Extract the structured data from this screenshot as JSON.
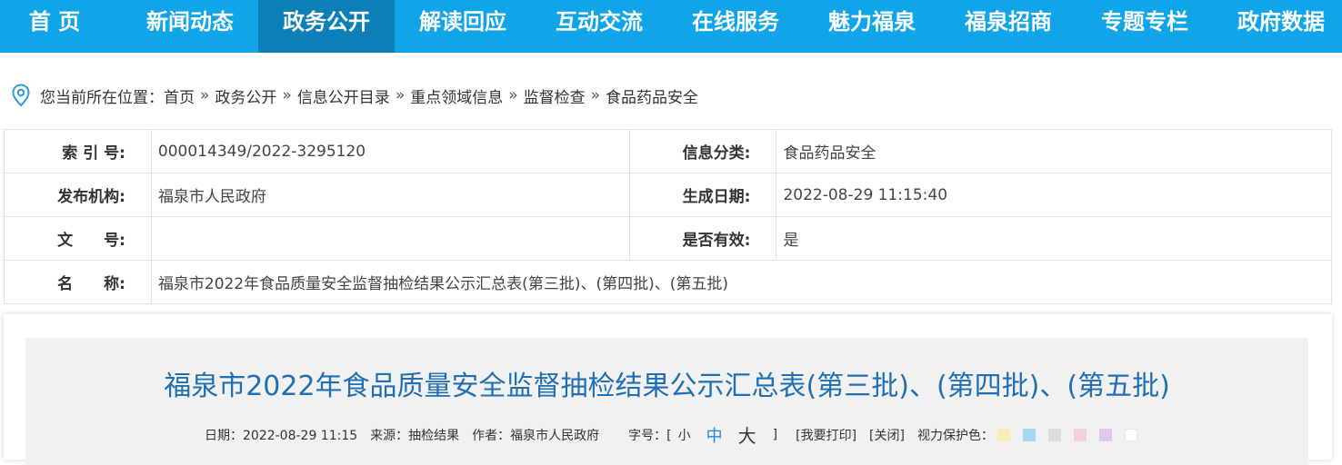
{
  "nav": {
    "items": [
      "首 页",
      "新闻动态",
      "政务公开",
      "解读回应",
      "互动交流",
      "在线服务",
      "魅力福泉",
      "福泉招商",
      "专题专栏",
      "政府数据"
    ],
    "active_index": 2
  },
  "breadcrumb": {
    "prefix": "您当前所在位置：",
    "items": [
      "首页",
      "政务公开",
      "信息公开目录",
      "重点领域信息",
      "监督检查",
      "食品药品安全"
    ],
    "separator": "»"
  },
  "meta": {
    "index_label": "索 引 号:",
    "index_value": "000014349/2022-3295120",
    "category_label": "信息分类:",
    "category_value": "食品药品安全",
    "publisher_label": "发布机构:",
    "publisher_value": "福泉市人民政府",
    "date_label": "生成日期:",
    "date_value": "2022-08-29 11:15:40",
    "docno_label": "文　　号:",
    "docno_value": "",
    "valid_label": "是否有效:",
    "valid_value": "是",
    "name_label": "名　　称:",
    "name_value": "福泉市2022年食品质量安全监督抽检结果公示汇总表(第三批)、(第四批)、(第五批)"
  },
  "article": {
    "title": "福泉市2022年食品质量安全监督抽检结果公示汇总表(第三批)、(第四批)、(第五批)",
    "date": "日期：2022-08-29 11:15",
    "source": "来源：抽检结果",
    "author": "作者：福泉市人民政府",
    "font_label": "字号：[",
    "font_small": "小",
    "font_medium": "中",
    "font_large": "大",
    "font_close": "]",
    "print": "[我要打印]",
    "close": "[关闭]",
    "eye_label": "视力保护色：",
    "swatches": [
      "#f7efb6",
      "#a7d8f3",
      "#dcdcdc",
      "#f7cfd8",
      "#e0c7f3",
      "#ffffff"
    ]
  }
}
